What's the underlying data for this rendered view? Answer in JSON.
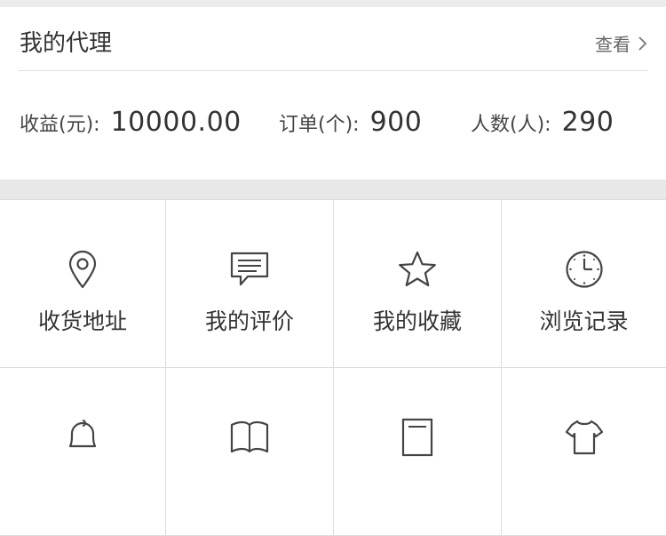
{
  "agent": {
    "title": "我的代理",
    "view_link": "查看",
    "stats": [
      {
        "label": "收益(元):",
        "value": "10000.00"
      },
      {
        "label": "订单(个):",
        "value": "900"
      },
      {
        "label": "人数(人):",
        "value": "290"
      }
    ]
  },
  "menu": {
    "items": [
      {
        "label": "收货地址",
        "icon": "location-pin-icon"
      },
      {
        "label": "我的评价",
        "icon": "comment-icon"
      },
      {
        "label": "我的收藏",
        "icon": "star-icon"
      },
      {
        "label": "浏览记录",
        "icon": "clock-icon"
      },
      {
        "label": "",
        "icon": "bell-icon"
      },
      {
        "label": "",
        "icon": "book-icon"
      },
      {
        "label": "",
        "icon": "document-icon"
      },
      {
        "label": "",
        "icon": "shirt-icon"
      }
    ]
  }
}
